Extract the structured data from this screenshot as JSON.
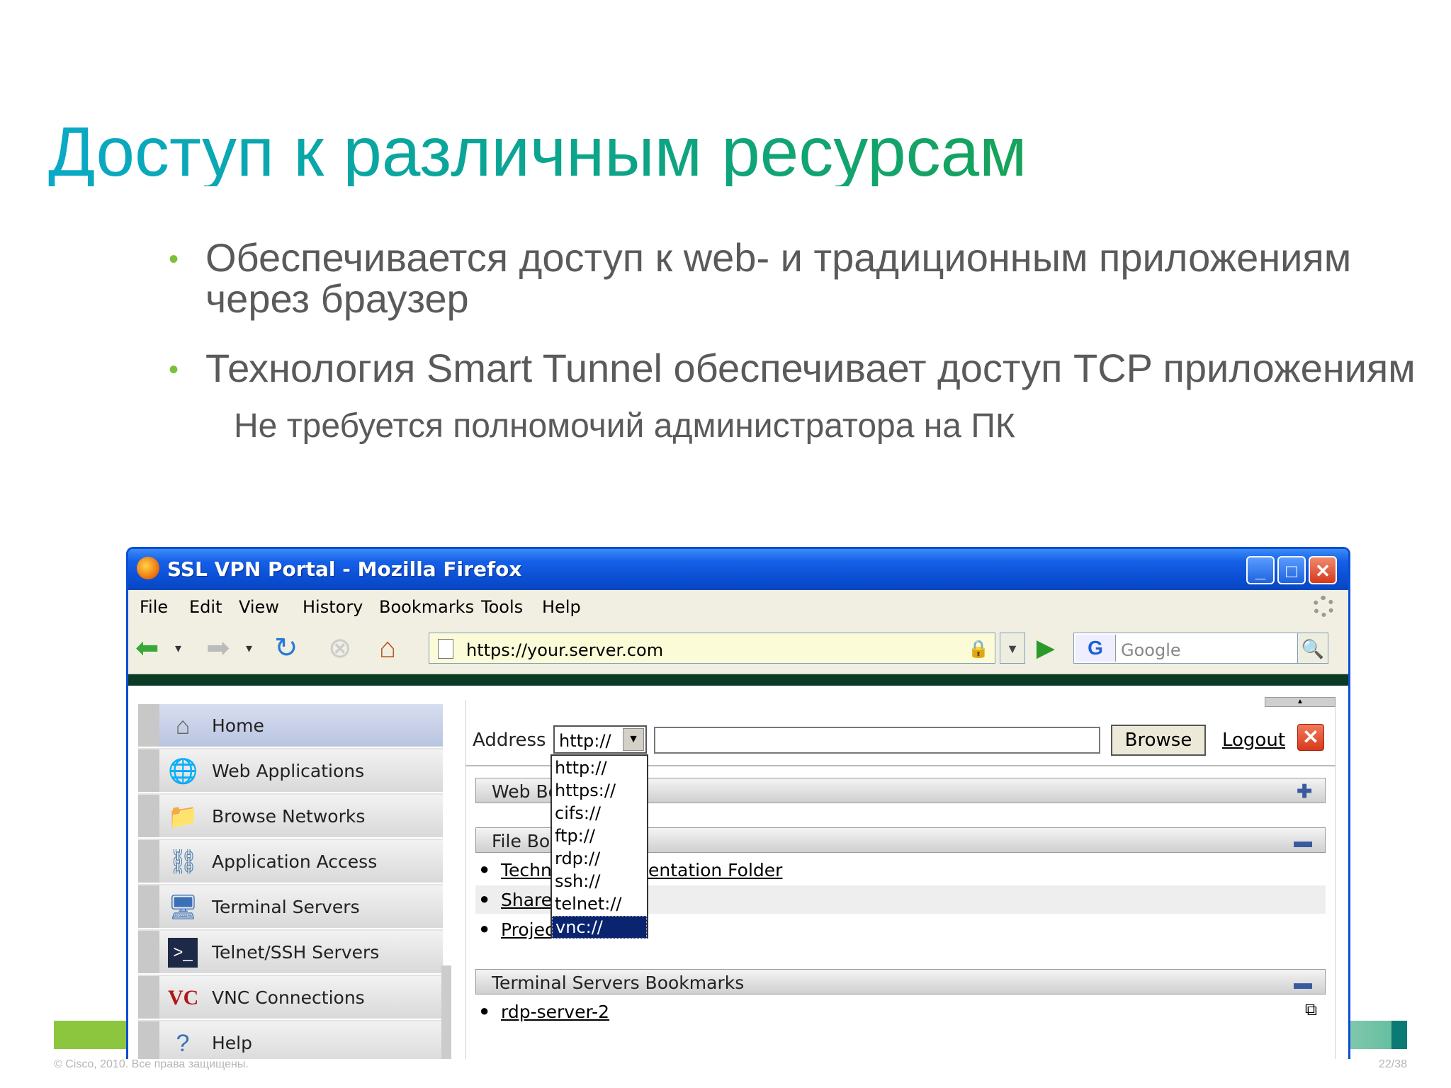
{
  "slide": {
    "title": "Доступ к различным ресурсам",
    "bullets": [
      {
        "line1": "Обеспечивается доступ к web- и традиционным приложениям",
        "line2": "через браузер"
      },
      {
        "line1": "Технология Smart Tunnel обеспечивает доступ TCP приложениям"
      }
    ],
    "sub_bullet": "Не  требуется полномочий администратора на ПК",
    "footer_copy": "© Cisco, 2010. Все права защищены.",
    "footer_page": "22/38"
  },
  "browser": {
    "title": "SSL VPN Portal - Mozilla Firefox",
    "menu": [
      "File",
      "Edit",
      "View",
      "History",
      "Bookmarks",
      "Tools",
      "Help"
    ],
    "url": "https://your.server.com",
    "search_placeholder": "Google",
    "search_engine_icon": "G"
  },
  "portal": {
    "sidebar": [
      {
        "label": "Home",
        "icon": "home-icon",
        "active": true
      },
      {
        "label": "Web Applications",
        "icon": "web-applications-icon"
      },
      {
        "label": "Browse Networks",
        "icon": "browse-networks-icon"
      },
      {
        "label": "Application Access",
        "icon": "application-access-icon"
      },
      {
        "label": "Terminal Servers",
        "icon": "terminal-servers-icon"
      },
      {
        "label": "Telnet/SSH Servers",
        "icon": "telnet-ssh-icon"
      },
      {
        "label": "VNC Connections",
        "icon": "vnc-icon"
      },
      {
        "label": "Help",
        "icon": "help-icon"
      }
    ],
    "address_label": "Address",
    "protocol_value": "http://",
    "protocol_options": [
      "http://",
      "https://",
      "cifs://",
      "ftp://",
      "rdp://",
      "ssh://",
      "telnet://",
      "vnc://"
    ],
    "protocol_highlighted": "vnc://",
    "browse_label": "Browse",
    "logout_label": "Logout",
    "sections": {
      "web_bookmarks_visible": "Web Bo",
      "file_bookmarks_visible": "File Bo",
      "terminal_servers": "Terminal Servers Bookmarks"
    },
    "file_bookmarks_visible": [
      {
        "left": "Techn",
        "right": "entation Folder"
      },
      {
        "left": "Share",
        "right": ""
      },
      {
        "left": "Projec",
        "right": ""
      }
    ],
    "terminal_bookmarks": [
      "rdp-server-2"
    ]
  }
}
